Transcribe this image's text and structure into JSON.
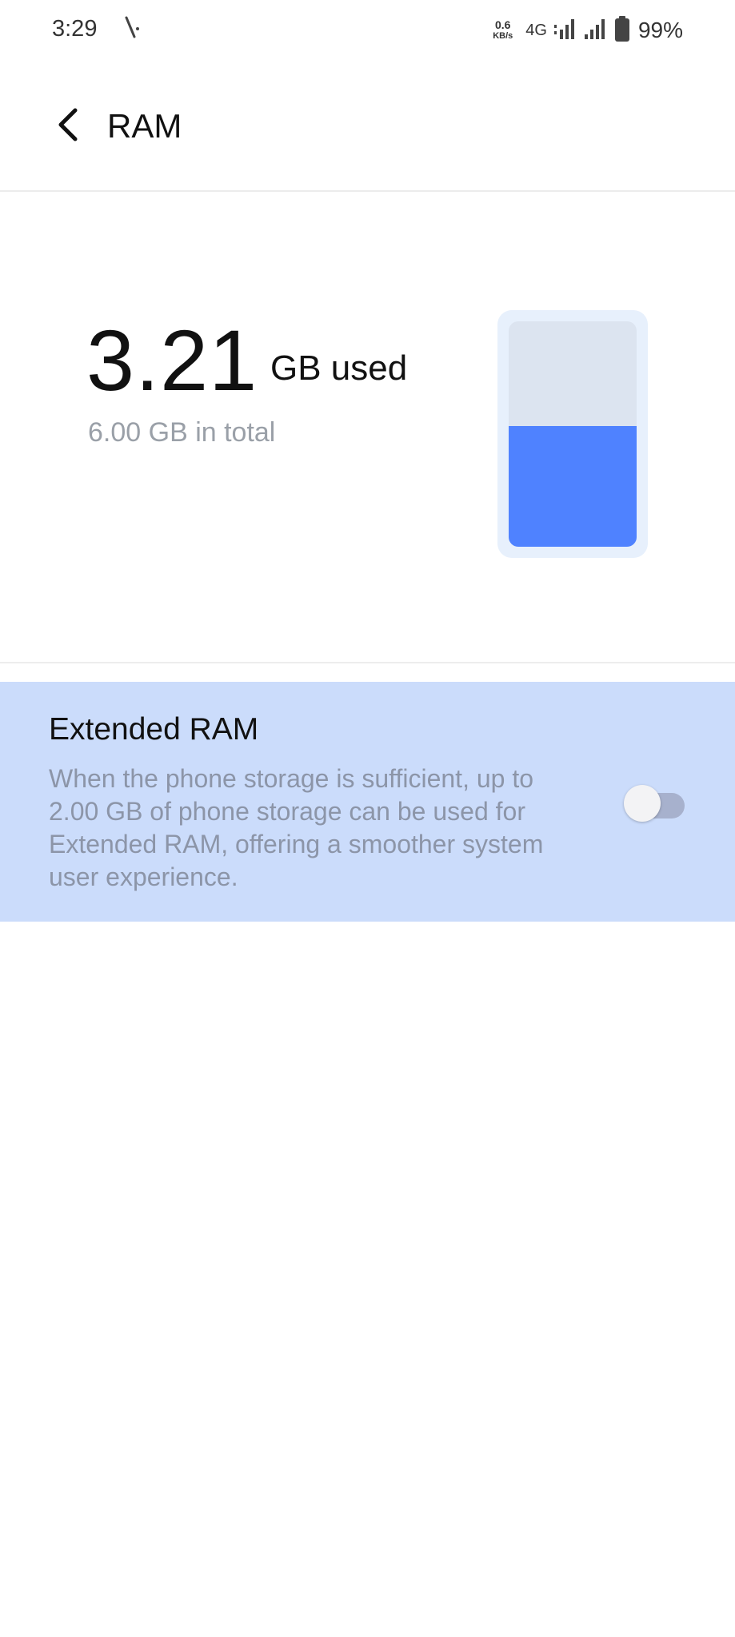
{
  "status_bar": {
    "time": "3:29",
    "net_speed_value": "0.6",
    "net_speed_unit": "KB/s",
    "network_type": "4G",
    "battery_percent": "99%"
  },
  "header": {
    "title": "RAM",
    "back_icon": "chevron-left-icon"
  },
  "summary": {
    "used_value": "3.21",
    "used_unit": "GB used",
    "total_text": "6.00 GB in total",
    "usage_fraction": 0.535,
    "fill_color": "#4f82ff"
  },
  "extended_ram": {
    "title": "Extended RAM",
    "description": "When the phone storage is sufficient, up to 2.00 GB of phone storage can be used for Extended RAM, offering a smoother system user experience.",
    "enabled": false
  },
  "colors": {
    "accent": "#4f82ff",
    "card_background": "#cbdcfb"
  }
}
